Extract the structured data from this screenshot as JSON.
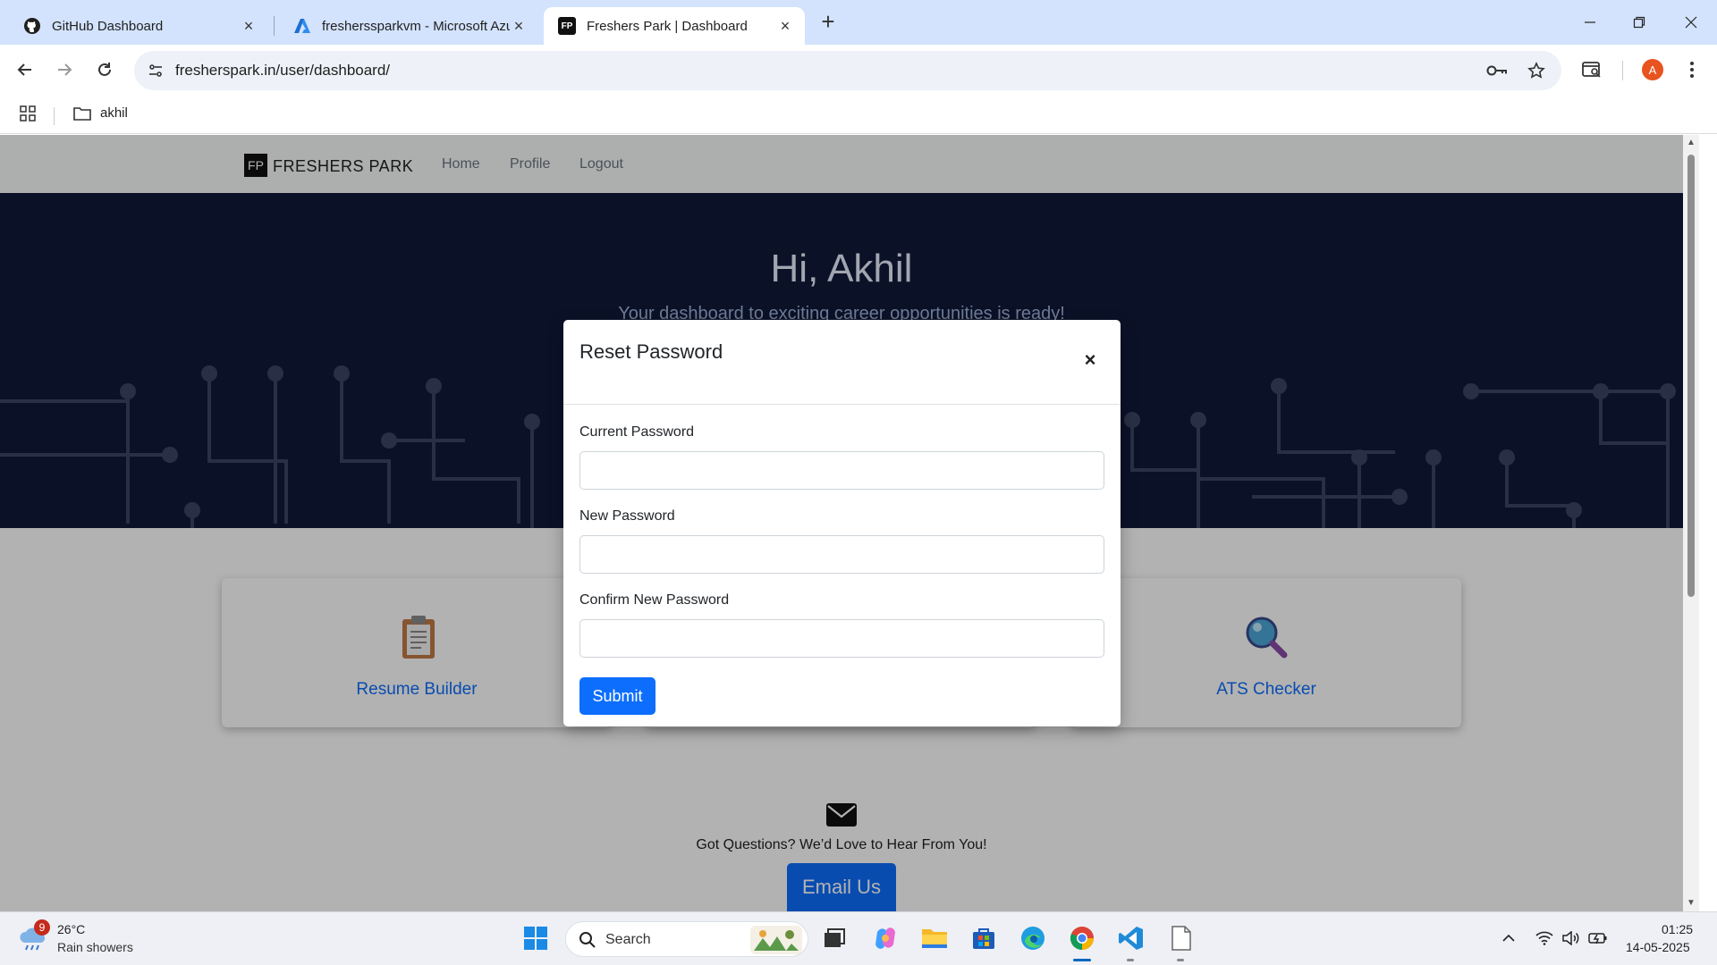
{
  "browser": {
    "tabs": [
      {
        "label": "GitHub Dashboard",
        "icon": "github-icon"
      },
      {
        "label": "fresherssparkvm - Microsoft Azu",
        "icon": "azure-icon"
      },
      {
        "label": "Freshers Park | Dashboard",
        "icon": "fp-icon",
        "active": true
      }
    ],
    "favicon_text": "FP",
    "url": "fresherspark.in/user/dashboard/",
    "profile_initial": "A",
    "bookmarks": [
      {
        "label": "akhil",
        "icon": "folder-icon"
      }
    ]
  },
  "site": {
    "logo_box": "FP",
    "logo_text": "FRESHERS PARK",
    "nav": [
      "Home",
      "Profile",
      "Logout"
    ],
    "hero_title": "Hi, Akhil",
    "hero_subtitle": "Your dashboard to exciting career opportunities is ready!",
    "cards": [
      {
        "label": "Resume Builder",
        "icon": "clipboard-icon"
      },
      {
        "label": "ATS Checker",
        "icon": "magnifier-icon"
      }
    ],
    "contact_text": "Got Questions? We’d Love to Hear From You!",
    "email_button": "Email Us"
  },
  "modal": {
    "title": "Reset Password",
    "close_glyph": "×",
    "fields": [
      {
        "label": "Current Password",
        "value": ""
      },
      {
        "label": "New Password",
        "value": ""
      },
      {
        "label": "Confirm New Password",
        "value": ""
      }
    ],
    "submit": "Submit"
  },
  "taskbar": {
    "weather_temp": "26°C",
    "weather_desc": "Rain showers",
    "weather_badge": "9",
    "search_label": "Search",
    "time": "01:25",
    "date": "14-05-2025"
  },
  "colors": {
    "accent": "#0d6efd",
    "hero_bg": "#101a3a",
    "tabstrip": "#d3e3fd"
  }
}
